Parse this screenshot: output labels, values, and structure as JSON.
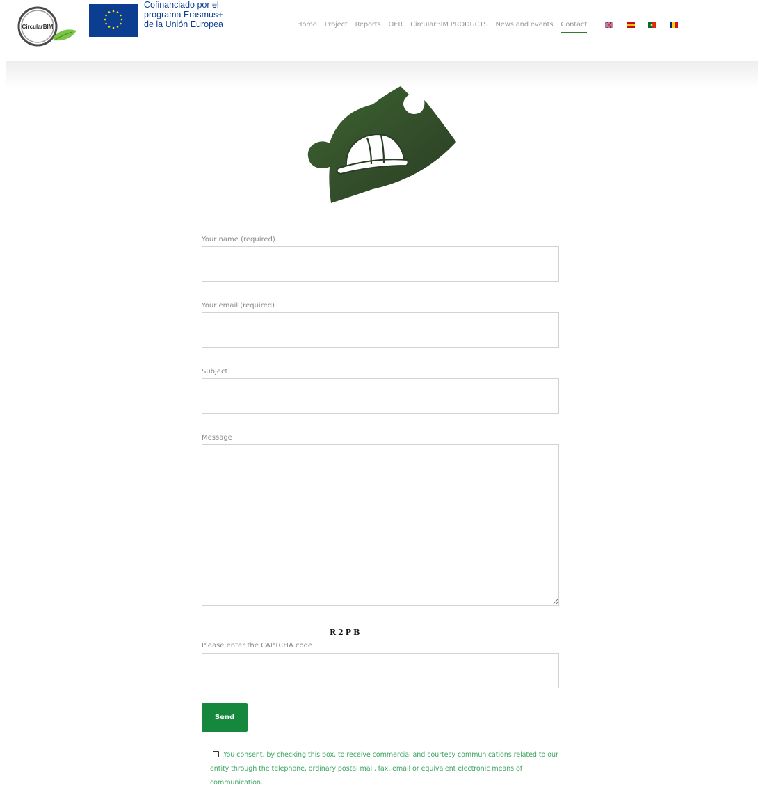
{
  "header": {
    "logo_text": "CircularBIM",
    "eu_text": [
      "Cofinanciado por el",
      "programa Erasmus+",
      "de la Unión Europea"
    ],
    "nav": [
      {
        "label": "Home"
      },
      {
        "label": "Project"
      },
      {
        "label": "Reports"
      },
      {
        "label": "OER"
      },
      {
        "label": "CircularBIM PRODUCTS"
      },
      {
        "label": "News and events"
      },
      {
        "label": "Contact",
        "active": true
      }
    ],
    "languages": [
      "uk-flag-icon",
      "spain-flag-icon",
      "portugal-flag-icon",
      "romania-flag-icon"
    ]
  },
  "form": {
    "name_label": "Your name (required)",
    "name_value": "",
    "email_label": "Your email (required)",
    "email_value": "",
    "subject_label": "Subject",
    "subject_value": "",
    "message_label": "Message",
    "message_value": "",
    "captcha_text": "R2PB",
    "captcha_label": "Please enter the CAPTCHA code",
    "captcha_value": "",
    "send_label": "Send",
    "consent_text": "You consent, by checking this box, to receive commercial and courtesy communications related to our entity through the telephone, ordinary postal mail, fax, email or equivalent electronic means of communication.",
    "consent_checked": false
  },
  "colors": {
    "accent_green": "#15883e",
    "consent_green": "#3fa662",
    "eu_blue": "#0b3d91",
    "puzzle_dark_green": "#2d4a25"
  }
}
